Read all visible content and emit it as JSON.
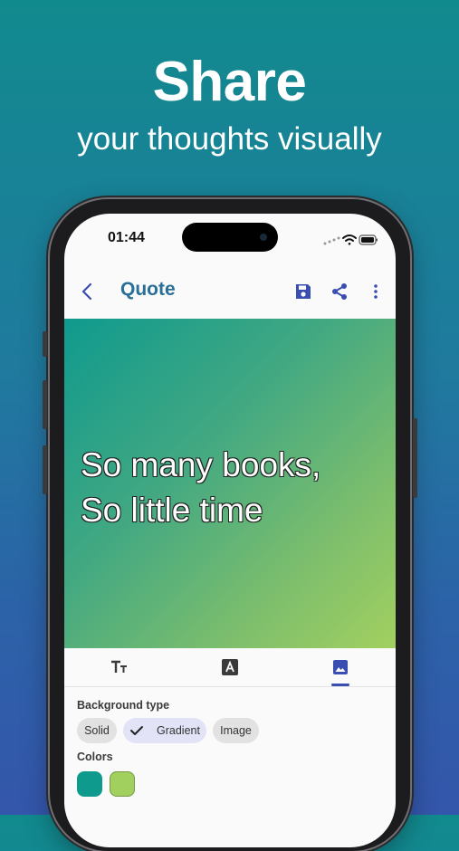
{
  "promo": {
    "headline": "Share",
    "subheadline": "your  thoughts visually"
  },
  "status_bar": {
    "time": "01:44"
  },
  "app_bar": {
    "title": "Quote",
    "icons": [
      "back-arrow-icon",
      "save-icon",
      "share-icon",
      "more-vertical-icon"
    ]
  },
  "quote": {
    "lines": [
      "So many books,",
      "So little time"
    ]
  },
  "tabs": [
    {
      "name": "text-style",
      "icon": "text-size-icon",
      "selected": false
    },
    {
      "name": "font",
      "icon": "font-a-icon",
      "selected": false
    },
    {
      "name": "background",
      "icon": "image-icon",
      "selected": true
    }
  ],
  "background": {
    "type_label": "Background type",
    "options": [
      {
        "label": "Solid",
        "selected": false
      },
      {
        "label": "Gradient",
        "selected": true
      },
      {
        "label": "Image",
        "selected": false
      }
    ],
    "colors_label": "Colors",
    "colors": [
      "#0f9a8e",
      "#a2d05f"
    ]
  },
  "colors": {
    "accent": "#3a4db0",
    "title": "#2a6f97"
  }
}
